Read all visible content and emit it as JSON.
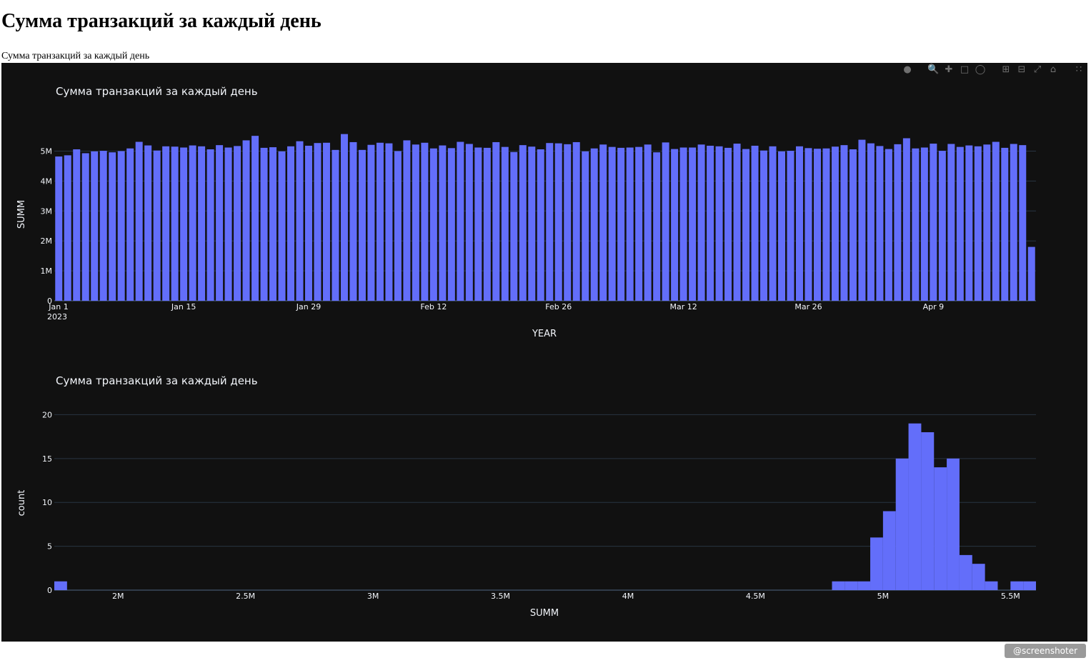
{
  "page": {
    "heading": "Сумма транзакций за каждый день",
    "caption": "Сумма транзакций за каждый день"
  },
  "modebar": {
    "icons": [
      "camera-icon",
      "zoom-icon",
      "pan-icon",
      "box-select-icon",
      "lasso-icon",
      "zoom-in-icon",
      "zoom-out-icon",
      "autoscale-icon",
      "home-icon",
      "plotly-logo-icon"
    ]
  },
  "colors": {
    "bar": "#636efa",
    "background": "#111111",
    "grid": "#283442",
    "text": "#f2f5fa"
  },
  "badge": {
    "text": "@screenshoter"
  },
  "chart_data": [
    {
      "type": "bar",
      "title": "Сумма транзакций за каждый день",
      "xlabel": "YEAR",
      "ylabel": "SUMM",
      "x_start": "2023-01-01",
      "x_ticks": [
        "Jan 1",
        "Jan 15",
        "Jan 29",
        "Feb 12",
        "Feb 26",
        "Mar 12",
        "Mar 26",
        "Apr 9"
      ],
      "x_tick_year": "2023",
      "y_ticks": [
        "0",
        "1M",
        "2M",
        "3M",
        "4M",
        "5M"
      ],
      "ylim": [
        0,
        5800000
      ],
      "values": [
        4820000,
        4860000,
        5060000,
        4930000,
        4990000,
        5010000,
        4960000,
        5000000,
        5090000,
        5310000,
        5190000,
        5020000,
        5160000,
        5150000,
        5120000,
        5190000,
        5160000,
        5060000,
        5200000,
        5120000,
        5170000,
        5360000,
        5510000,
        5110000,
        5130000,
        4990000,
        5160000,
        5330000,
        5180000,
        5270000,
        5280000,
        5040000,
        5570000,
        5300000,
        5040000,
        5210000,
        5280000,
        5260000,
        5000000,
        5360000,
        5220000,
        5280000,
        5090000,
        5190000,
        5100000,
        5310000,
        5240000,
        5120000,
        5110000,
        5300000,
        5140000,
        4970000,
        5200000,
        5150000,
        5060000,
        5270000,
        5260000,
        5230000,
        5300000,
        4990000,
        5090000,
        5220000,
        5140000,
        5110000,
        5120000,
        5140000,
        5220000,
        4960000,
        5290000,
        5070000,
        5120000,
        5120000,
        5220000,
        5180000,
        5160000,
        5110000,
        5250000,
        5070000,
        5180000,
        5020000,
        5160000,
        4990000,
        5010000,
        5160000,
        5100000,
        5080000,
        5090000,
        5150000,
        5200000,
        5060000,
        5380000,
        5260000,
        5170000,
        5070000,
        5230000,
        5430000,
        5090000,
        5120000,
        5250000,
        5010000,
        5240000,
        5140000,
        5190000,
        5160000,
        5220000,
        5310000,
        5110000,
        5240000,
        5200000,
        1800000
      ]
    },
    {
      "type": "bar",
      "subtype": "histogram",
      "title": "Сумма транзакций за каждый день",
      "xlabel": "SUMM",
      "ylabel": "count",
      "x_ticks": [
        "2M",
        "2.5M",
        "3M",
        "3.5M",
        "4M",
        "4.5M",
        "5M",
        "5.5M"
      ],
      "y_ticks": [
        "0",
        "5",
        "10",
        "15",
        "20"
      ],
      "xlim": [
        1750000,
        5600000
      ],
      "ylim": [
        0,
        21.5
      ],
      "bin_width": 50000,
      "bins": [
        {
          "x0": 1750000,
          "count": 1
        },
        {
          "x0": 4800000,
          "count": 1
        },
        {
          "x0": 4850000,
          "count": 1
        },
        {
          "x0": 4900000,
          "count": 1
        },
        {
          "x0": 4950000,
          "count": 6
        },
        {
          "x0": 5000000,
          "count": 9
        },
        {
          "x0": 5050000,
          "count": 15
        },
        {
          "x0": 5100000,
          "count": 19
        },
        {
          "x0": 5150000,
          "count": 18
        },
        {
          "x0": 5200000,
          "count": 14
        },
        {
          "x0": 5250000,
          "count": 15
        },
        {
          "x0": 5300000,
          "count": 4
        },
        {
          "x0": 5350000,
          "count": 3
        },
        {
          "x0": 5400000,
          "count": 1
        },
        {
          "x0": 5500000,
          "count": 1
        },
        {
          "x0": 5550000,
          "count": 1
        }
      ]
    }
  ]
}
